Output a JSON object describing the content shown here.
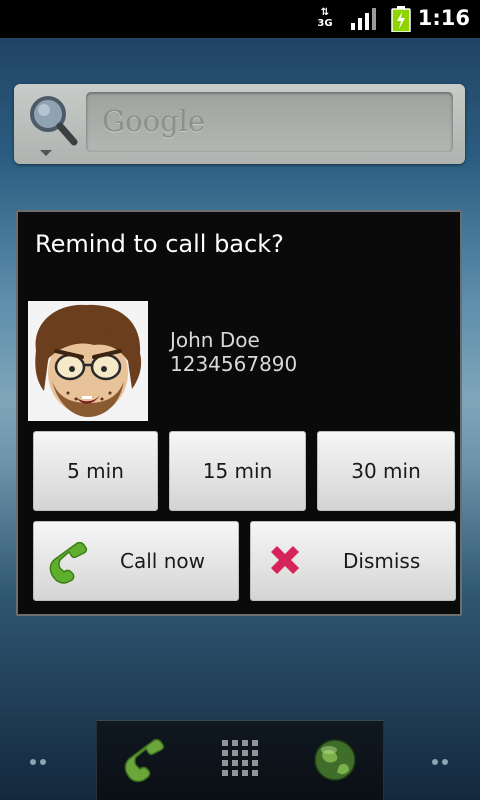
{
  "status_bar": {
    "time": "1:16",
    "network": "3G"
  },
  "search": {
    "placeholder": "Google"
  },
  "dialog": {
    "title": "Remind to call back?",
    "contact": {
      "name": "John Doe",
      "number": "1234567890"
    },
    "snooze_options": [
      "5 min",
      "15 min",
      "30 min"
    ],
    "actions": {
      "call_label": "Call now",
      "dismiss_label": "Dismiss"
    }
  },
  "icons": {
    "search": "search-icon",
    "phone": "phone-icon",
    "dismiss": "close-icon",
    "apps": "app-drawer-icon",
    "browser": "globe-icon"
  },
  "colors": {
    "call_green": "#5fae2e",
    "dismiss_red": "#d6245a",
    "dialog_bg": "#0a0a0a"
  }
}
